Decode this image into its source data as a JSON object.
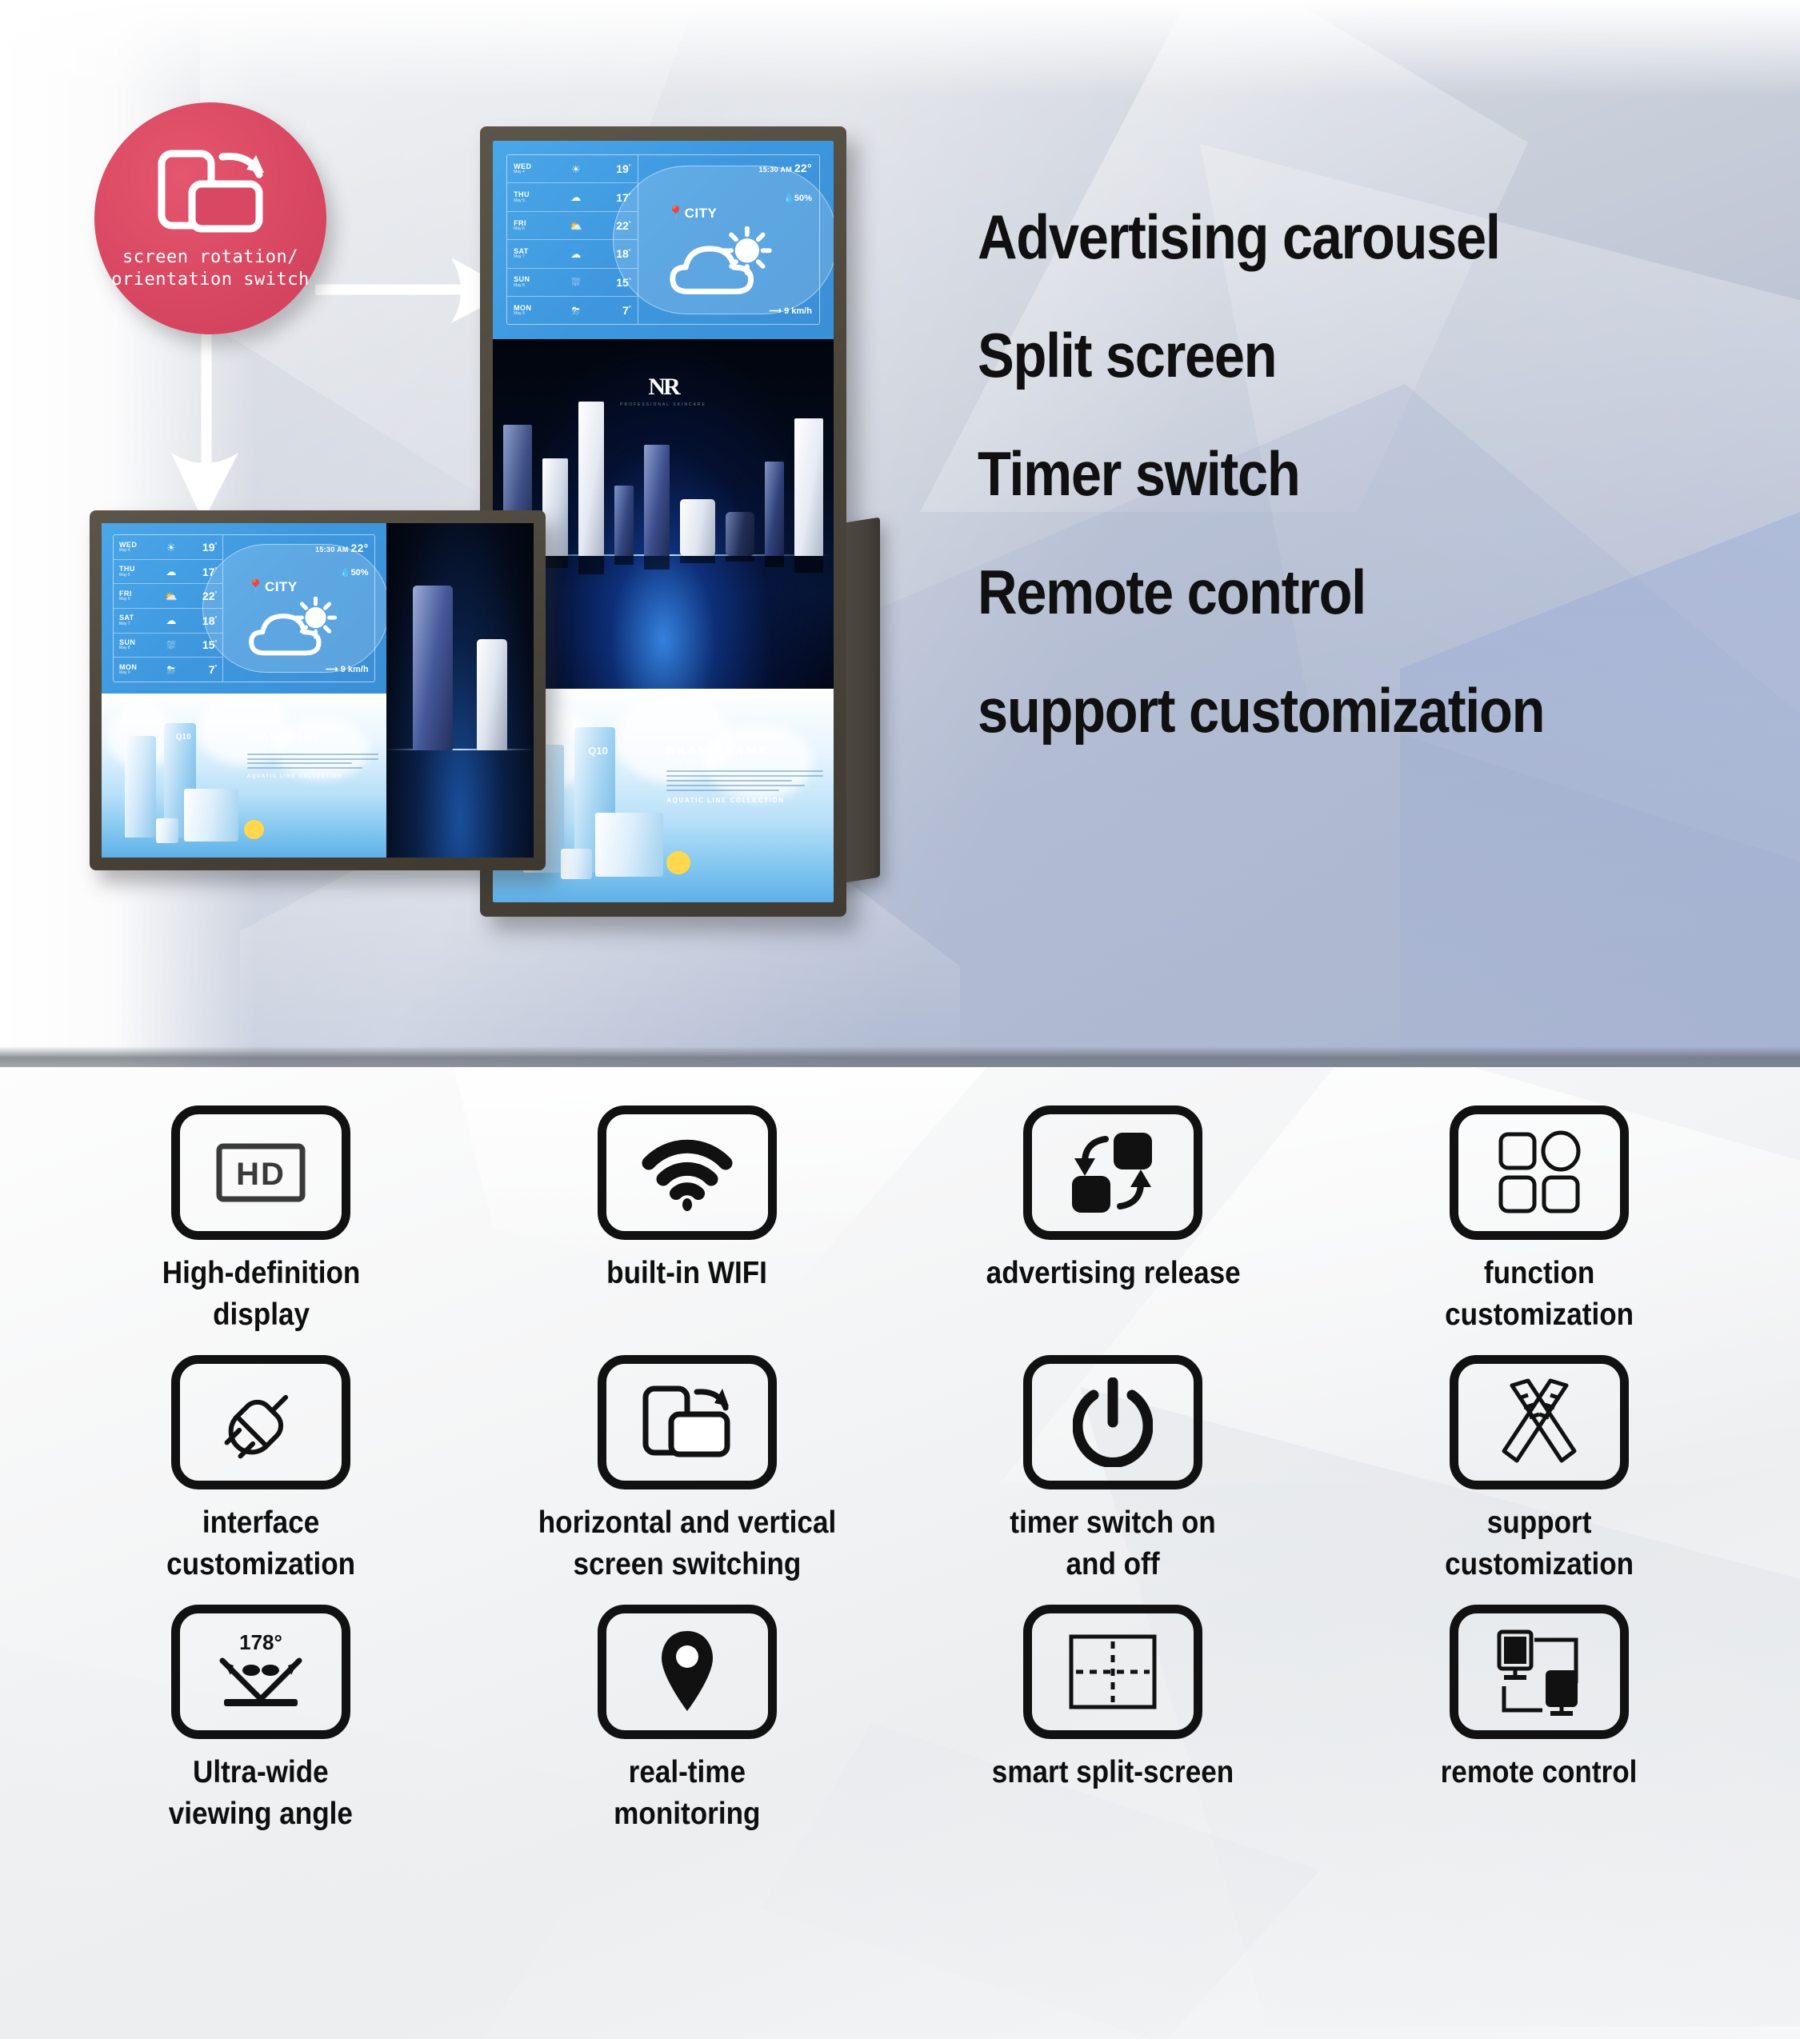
{
  "hero": {
    "headlines": [
      "Advertising carousel",
      "Split screen",
      "Timer switch",
      "Remote control",
      "support customization"
    ],
    "badge": {
      "label": "screen rotation/\norientation switch",
      "icon": "screen-rotation-icon",
      "color": "#d94862"
    },
    "arrows": [
      {
        "name": "arrow-to-portrait-display",
        "direction": "right"
      },
      {
        "name": "arrow-to-landscape-display",
        "direction": "down"
      }
    ],
    "background_colors": {
      "gradient_start": "#e8eaed",
      "gradient_end": "#a9b5d0"
    }
  },
  "weather_widget": {
    "forecast": [
      {
        "day": "WED",
        "date": "May 4",
        "icon": "sun-icon",
        "temp": "19",
        "unit": "°"
      },
      {
        "day": "THU",
        "date": "May 5",
        "icon": "wind-cloud-icon",
        "temp": "17",
        "unit": "°"
      },
      {
        "day": "FRI",
        "date": "May 6",
        "icon": "sun-cloud-icon",
        "temp": "22",
        "unit": "°"
      },
      {
        "day": "SAT",
        "date": "May 7",
        "icon": "cloud-icon",
        "temp": "18",
        "unit": "°"
      },
      {
        "day": "SUN",
        "date": "May 8",
        "icon": "rain-cloud-icon",
        "temp": "15",
        "unit": "°"
      },
      {
        "day": "MON",
        "date": "May 9",
        "icon": "snow-cloud-icon",
        "temp": "7",
        "unit": "°"
      }
    ],
    "time": "15:30 AM",
    "current_temp": "22°",
    "humidity": "50%",
    "city": "CITY",
    "wind": "9 km/h",
    "main_icon": "sun-behind-cloud-icon",
    "accent_color": "#3e97de"
  },
  "ad_cosmetics": {
    "brand_mark": "NR",
    "brand_sub": "PROFESSIONAL SKINCARE"
  },
  "ad_brand": {
    "title": "BRAND NAME",
    "subtitle": "COSMETICS",
    "collection": "AQUATIC LINE COLLECTION",
    "product_label": "Q10"
  },
  "features": {
    "items": [
      {
        "label": "High-definition\ndisplay",
        "icon": "hd-display-icon"
      },
      {
        "label": "built-in WIFI",
        "icon": "wifi-icon"
      },
      {
        "label": "advertising release",
        "icon": "advertising-release-icon"
      },
      {
        "label": "function\ncustomization",
        "icon": "function-customization-icon"
      },
      {
        "label": "interface\ncustomization",
        "icon": "plug-connector-icon"
      },
      {
        "label": "horizontal and vertical\nscreen switching",
        "icon": "screen-rotation-icon"
      },
      {
        "label": "timer switch on\nand off",
        "icon": "power-icon"
      },
      {
        "label": "support\ncustomization",
        "icon": "ruler-pencil-icon"
      },
      {
        "label": "Ultra-wide\nviewing angle",
        "icon": "viewing-angle-icon",
        "badge": "178°"
      },
      {
        "label": "real-time\nmonitoring",
        "icon": "location-pin-icon"
      },
      {
        "label": "smart split-screen",
        "icon": "split-screen-icon"
      },
      {
        "label": "remote control",
        "icon": "remote-control-icon"
      }
    ],
    "icon_color": "#111111",
    "label_color": "#0e0e0e"
  }
}
